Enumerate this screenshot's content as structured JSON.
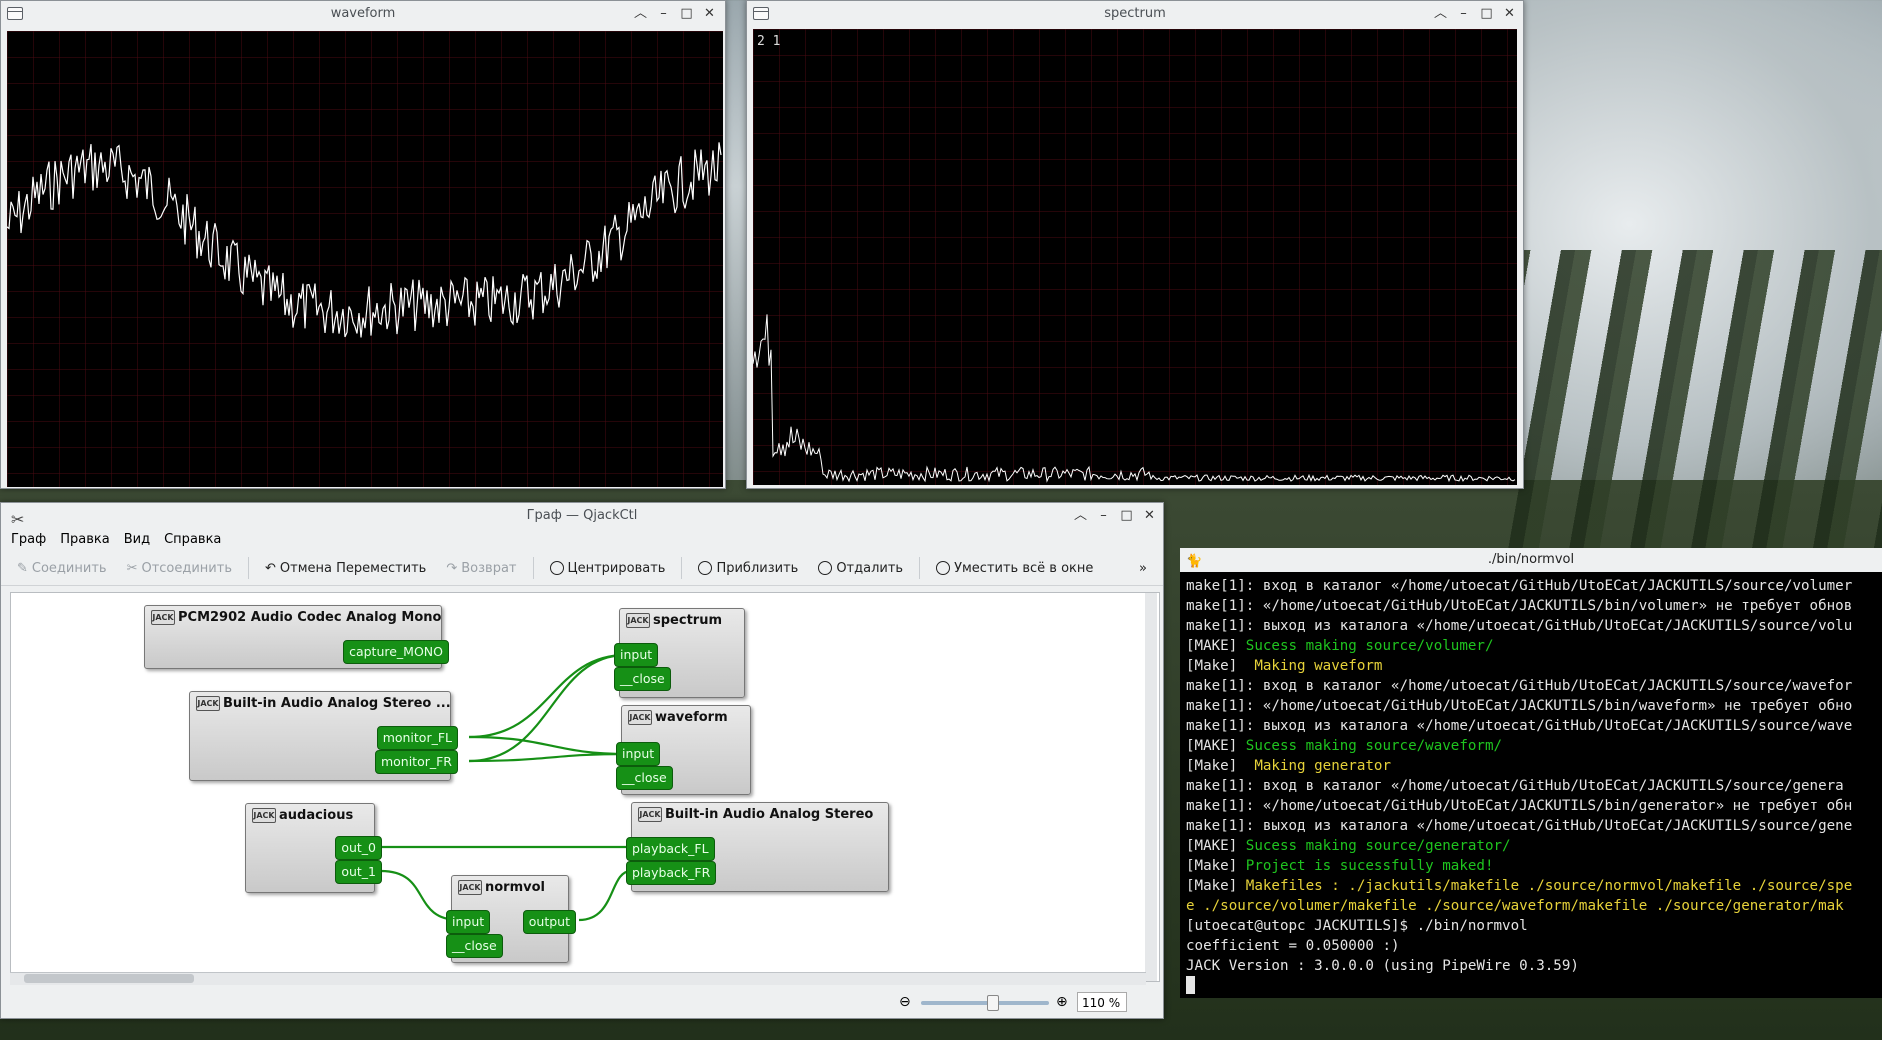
{
  "waveform_window": {
    "title": "waveform"
  },
  "spectrum_window": {
    "title": "spectrum",
    "overlay": "2 1"
  },
  "graph_window": {
    "title": "Граф — QjackCtl",
    "menu": [
      "Граф",
      "Правка",
      "Вид",
      "Справка"
    ],
    "toolbar": {
      "connect": "Соединить",
      "disconnect": "Отсоединить",
      "undo": "Отмена Переместить",
      "redo": "Возврат",
      "center": "Центрировать",
      "zoom_in": "Приблизить",
      "zoom_out": "Отдалить",
      "fit": "Уместить всё в окне",
      "more": "»"
    },
    "zoom": "110 %",
    "nodes": {
      "pcm": {
        "title": "PCM2902 Audio Codec Analog Mono",
        "ports": [
          "capture_MONO"
        ]
      },
      "builtin_mon": {
        "title": "Built-in Audio Analog Stereo ...",
        "ports": [
          "monitor_FL",
          "monitor_FR"
        ]
      },
      "spectrum": {
        "title": "spectrum",
        "ports": [
          "input",
          "__close"
        ]
      },
      "waveform": {
        "title": "waveform",
        "ports": [
          "input",
          "__close"
        ]
      },
      "audacious": {
        "title": "audacious",
        "ports": [
          "out_0",
          "out_1"
        ]
      },
      "builtin_play": {
        "title": "Built-in Audio Analog Stereo",
        "ports": [
          "playback_FL",
          "playback_FR"
        ]
      },
      "normvol": {
        "title": "normvol",
        "ports": [
          "input",
          "__close",
          "output"
        ]
      }
    },
    "jack_badge": "JACK"
  },
  "terminal": {
    "title": "./bin/normvol",
    "lines": [
      {
        "t": "make[1]: вход в каталог «/home/utoecat/GitHub/UtoECat/JACKUTILS/source/volumer",
        "c": ""
      },
      {
        "t": "make[1]: «/home/utoecat/GitHub/UtoECat/JACKUTILS/bin/volumer» не требует обнов",
        "c": ""
      },
      {
        "t": "make[1]: выход из каталога «/home/utoecat/GitHub/UtoECat/JACKUTILS/source/volu",
        "c": ""
      },
      {
        "p": "[MAKE] ",
        "t": "Sucess making source/volumer/",
        "c": "g"
      },
      {
        "p": "[Make]  ",
        "t": "Making waveform",
        "c": "y"
      },
      {
        "t": "make[1]: вход в каталог «/home/utoecat/GitHub/UtoECat/JACKUTILS/source/wavefor",
        "c": ""
      },
      {
        "t": "make[1]: «/home/utoecat/GitHub/UtoECat/JACKUTILS/bin/waveform» не требует обно",
        "c": ""
      },
      {
        "t": "make[1]: выход из каталога «/home/utoecat/GitHub/UtoECat/JACKUTILS/source/wave",
        "c": ""
      },
      {
        "p": "[MAKE] ",
        "t": "Sucess making source/waveform/",
        "c": "g"
      },
      {
        "p": "[Make]  ",
        "t": "Making generator",
        "c": "y"
      },
      {
        "t": "make[1]: вход в каталог «/home/utoecat/GitHub/UtoECat/JACKUTILS/source/genera",
        "c": ""
      },
      {
        "t": "make[1]: «/home/utoecat/GitHub/UtoECat/JACKUTILS/bin/generator» не требует обн",
        "c": ""
      },
      {
        "t": "make[1]: выход из каталога «/home/utoecat/GitHub/UtoECat/JACKUTILS/source/gene",
        "c": ""
      },
      {
        "p": "[MAKE] ",
        "t": "Sucess making source/generator/",
        "c": "g"
      },
      {
        "p": "[Make] ",
        "t": "Project is sucessfully maked!",
        "c": "g"
      },
      {
        "p": "[Make] ",
        "t": "Makefiles : ./jackutils/makefile ./source/normvol/makefile ./source/spe",
        "c": "y"
      },
      {
        "t": "e ./source/volumer/makefile ./source/waveform/makefile ./source/generator/mak",
        "c": "y"
      },
      {
        "t": "[utoecat@utopc JACKUTILS]$ ./bin/normvol",
        "c": ""
      },
      {
        "t": "coefficient = 0.050000 :)",
        "c": ""
      },
      {
        "t": "JACK Version : 3.0.0.0 (using PipeWire 0.3.59)",
        "c": ""
      }
    ]
  }
}
